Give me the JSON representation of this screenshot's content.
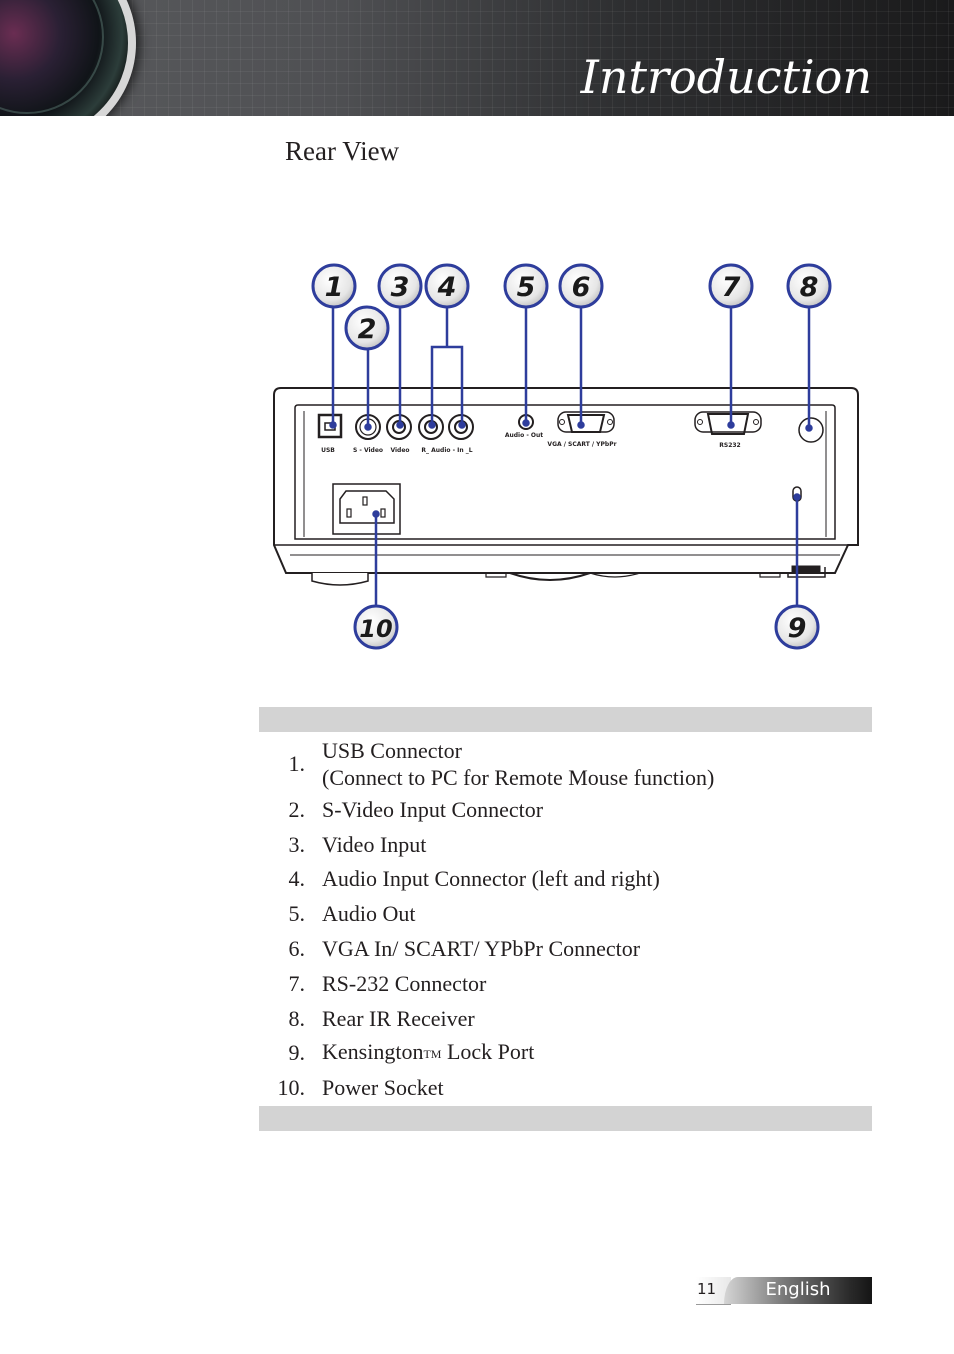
{
  "header": {
    "title": "Introduction",
    "lens_icon": "projector-lens-icon"
  },
  "section": {
    "title": "Rear View"
  },
  "diagram": {
    "callout_color": "#2e3d9c",
    "callouts": [
      "1",
      "2",
      "3",
      "4",
      "5",
      "6",
      "7",
      "8",
      "9",
      "10"
    ],
    "port_labels": {
      "usb": "USB",
      "svideo": "S - Video",
      "video": "Video",
      "audio_in": "R_  Audio - In  _L",
      "audio_out": "Audio - Out",
      "vga": "VGA / SCART / YPbPr",
      "rs232": "RS232"
    }
  },
  "items": [
    {
      "num": "1.",
      "line1": "USB Connector",
      "line2": "(Connect to PC for Remote Mouse function)"
    },
    {
      "num": "2.",
      "text": "S-Video Input Connector"
    },
    {
      "num": "3.",
      "text": "Video Input"
    },
    {
      "num": "4.",
      "text": "Audio Input Connector (left and right)"
    },
    {
      "num": "5.",
      "text": "Audio Out"
    },
    {
      "num": "6.",
      "text": "VGA In/ SCART/ YPbPr Connector"
    },
    {
      "num": "7.",
      "text": "RS-232 Connector"
    },
    {
      "num": "8.",
      "text": "Rear IR Receiver"
    },
    {
      "num": "9.",
      "text": "Kensington",
      "tm": "TM",
      "text_after": " Lock Port"
    },
    {
      "num": "10.",
      "text": "Power Socket"
    }
  ],
  "footer": {
    "page_number": "11",
    "language": "English"
  }
}
